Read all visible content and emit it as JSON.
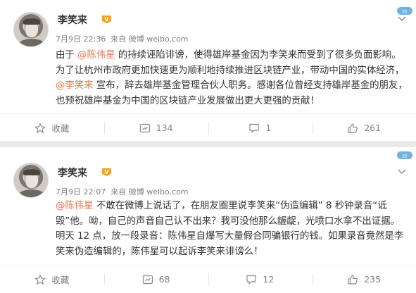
{
  "posts": [
    {
      "author": "李笑来",
      "time": "7月9日 22:36",
      "source": "来自 微博 weibo.com",
      "segments": [
        {
          "text": "由于 "
        },
        {
          "text": "@陈伟星",
          "mention": true
        },
        {
          "text": " 的持续诬陷诽谤，使得雄岸基金因为李笑来而受到了很多负面影响。为了让杭州市政府更加快速更为顺利地持续推进区块链产业，带动中国的实体经济，"
        },
        {
          "text": "@李笑来",
          "mention": true
        },
        {
          "text": " 宣布，辞去雄岸基金管理合伙人职务。感谢各位曾经支持雄岸基金的朋友，也预祝雄岸基金为中国的区块链产业发展做出更大更强的贡献！"
        }
      ],
      "actions": {
        "favorite": "收藏",
        "repost": "134",
        "comment": "1",
        "like": "261"
      }
    },
    {
      "author": "李笑来",
      "time": "7月9日 22:07",
      "source": "来自 微博 weibo.com",
      "segments": [
        {
          "text": "@陈伟星",
          "mention": true
        },
        {
          "text": " 不敢在微博上说话了，在朋友圈里说李笑来“伪造编辑” 8 秒钟录音“诋毁”他。呦，自己的声音自己认不出来？我可没他那么龌龊，光喷口水拿不出证据。明天 12 点，放一段录音：陈伟星自爆写大量假合同骗银行的钱。如果录音竟然是李笑来伪造编辑的，陈伟星可以起诉李笑来诽谤么！"
        }
      ],
      "actions": {
        "favorite": "收藏",
        "repost": "68",
        "comment": "12",
        "like": "235"
      }
    }
  ],
  "colors": {
    "mention": "#eb7350",
    "vip": "#f7a21a",
    "meta": "#808080",
    "text": "#333333"
  }
}
